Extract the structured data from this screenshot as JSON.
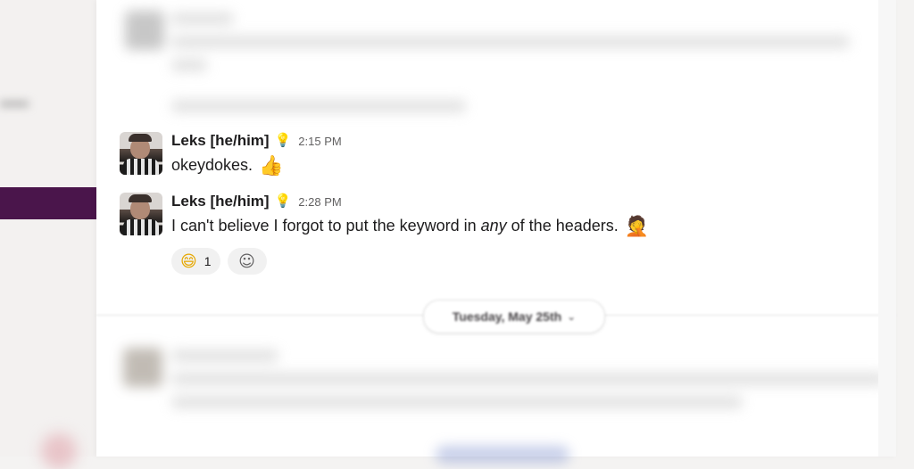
{
  "messages": [
    {
      "name": "Leks [he/him]",
      "status_icon": "lightbulb-icon",
      "time": "2:15 PM",
      "text": "okeydokes.",
      "trailing_emoji": "thumbs-up-icon"
    },
    {
      "name": "Leks [he/him]",
      "status_icon": "lightbulb-icon",
      "time": "2:28 PM",
      "text_before": "I can't believe I forgot to put the keyword in ",
      "text_emphasis": "any",
      "text_after": " of the headers.",
      "trailing_emoji": "facepalm-icon",
      "reactions": [
        {
          "emoji": "grinning-face-icon",
          "count": "1"
        }
      ],
      "add_reaction_icon": "add-reaction-icon"
    }
  ],
  "day_divider": {
    "label": "Tuesday, May 25th"
  },
  "colors": {
    "sidebar_active": "#4a154b",
    "status_bulb": "#e8c11a",
    "timestamp": "#616061"
  }
}
